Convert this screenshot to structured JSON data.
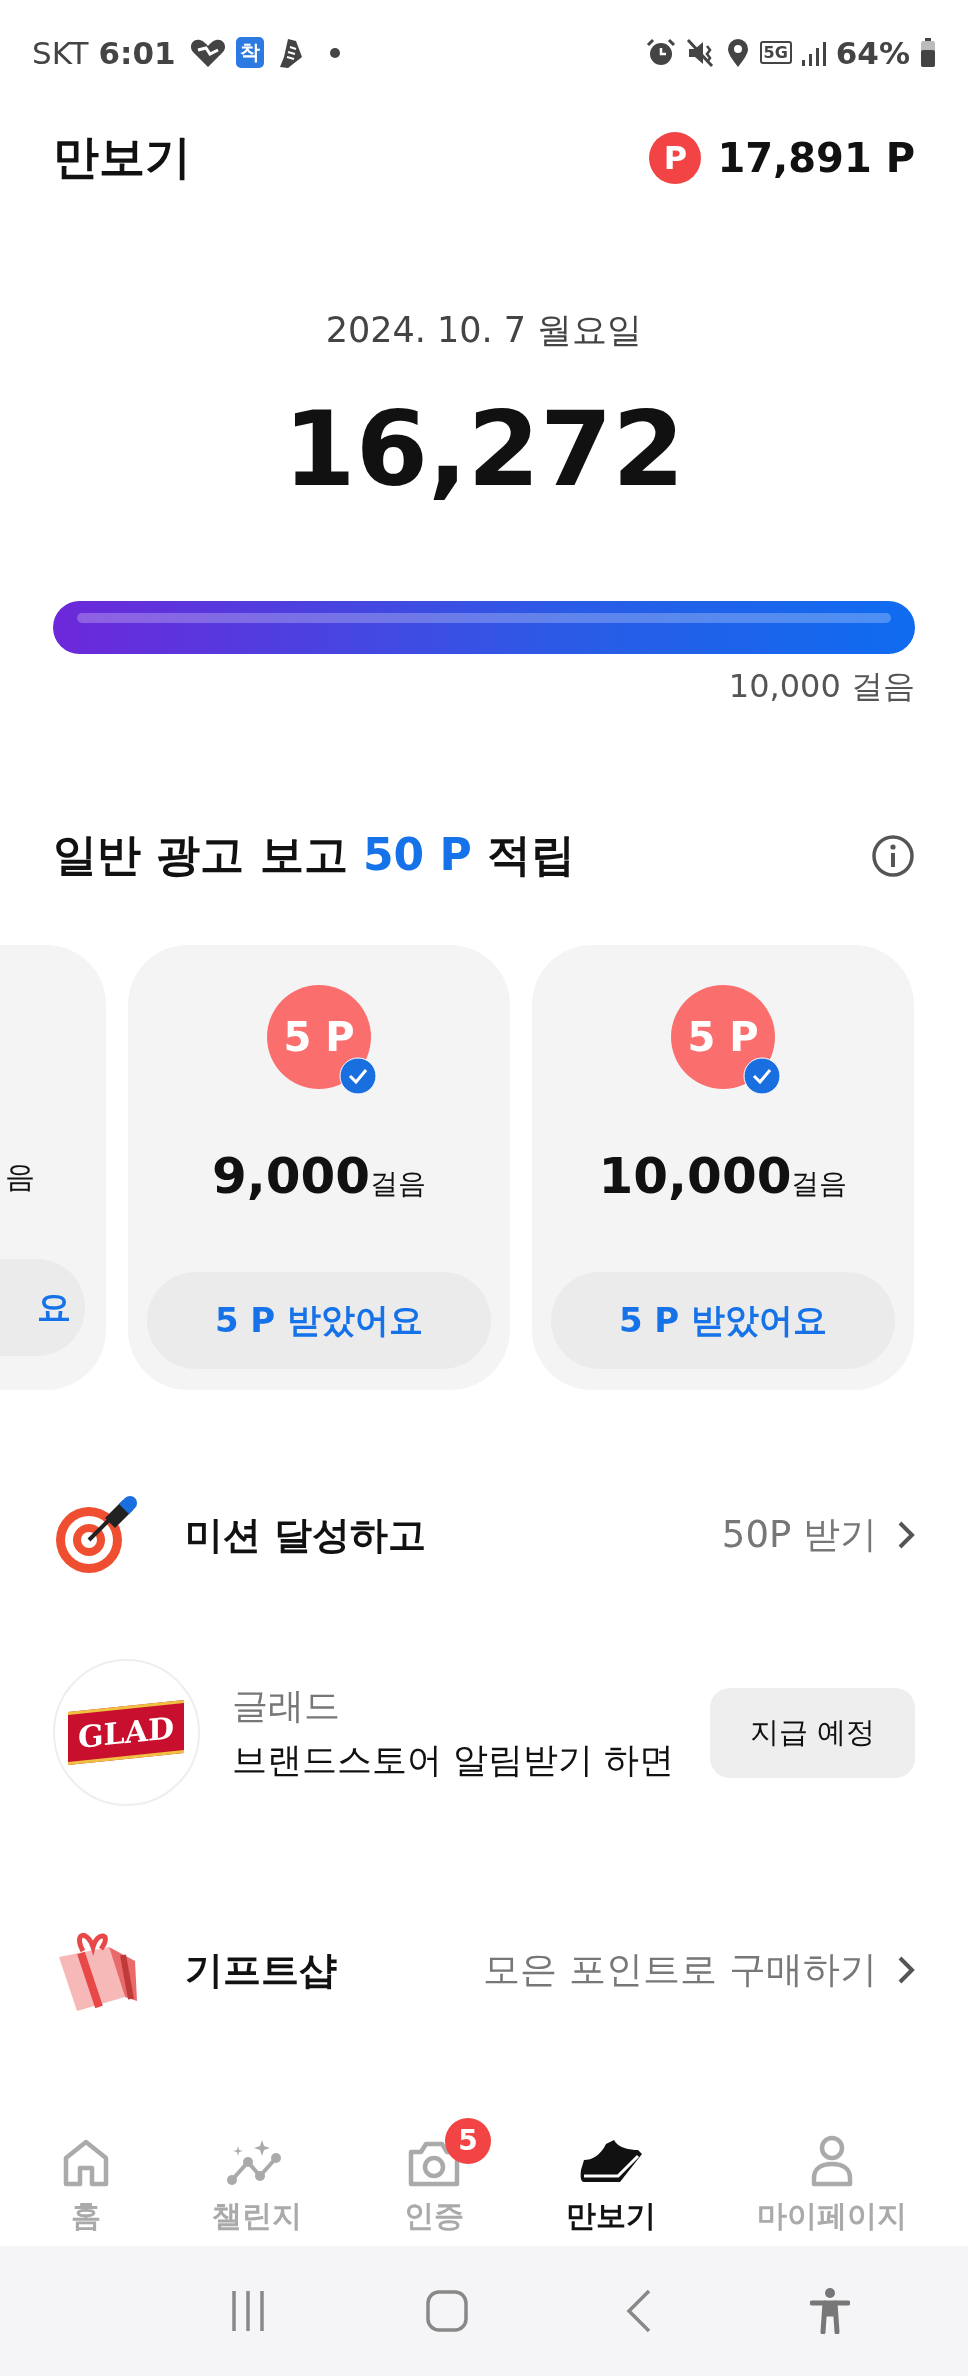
{
  "status_bar": {
    "carrier": "SKT",
    "time": "6:01",
    "app_badge": "착",
    "network": "5G",
    "battery": "64%"
  },
  "header": {
    "title": "만보기",
    "points": "17,891 P",
    "points_symbol": "P"
  },
  "steps": {
    "date": "2024. 10. 7 월요일",
    "count": "16,272",
    "goal": "10,000 걸음"
  },
  "ad_section": {
    "title_start": "일반 광고 보고 ",
    "title_highlight": "50 P",
    "title_end": " 적립",
    "cards": [
      {
        "kind": "partial",
        "unit": "음",
        "button": "요"
      },
      {
        "kind": "full",
        "coin": "5 P",
        "checked": true,
        "steps": "9,000",
        "unit": "걸음",
        "button": "5 P 받았어요"
      },
      {
        "kind": "full",
        "coin": "5 P",
        "checked": true,
        "steps": "10,000",
        "unit": "걸음",
        "button": "5 P 받았어요"
      }
    ]
  },
  "mission": {
    "label": "미션 달성하고",
    "action": "50P 받기"
  },
  "brand": {
    "logo": "GLAD",
    "name": "글래드",
    "description": "브랜드스토어 알림받기 하면",
    "button": "지급 예정"
  },
  "gift_shop": {
    "label": "기프트샵",
    "action": "모은 포인트로 구매하기"
  },
  "tab_bar": [
    {
      "kind": "home",
      "label": "홈",
      "selected": false
    },
    {
      "kind": "challenge",
      "label": "챌린지",
      "selected": false
    },
    {
      "kind": "camera",
      "label": "인증",
      "selected": false,
      "badge": "5"
    },
    {
      "kind": "shoe",
      "label": "만보기",
      "selected": true
    },
    {
      "kind": "person",
      "label": "마이페이지",
      "selected": false
    }
  ]
}
